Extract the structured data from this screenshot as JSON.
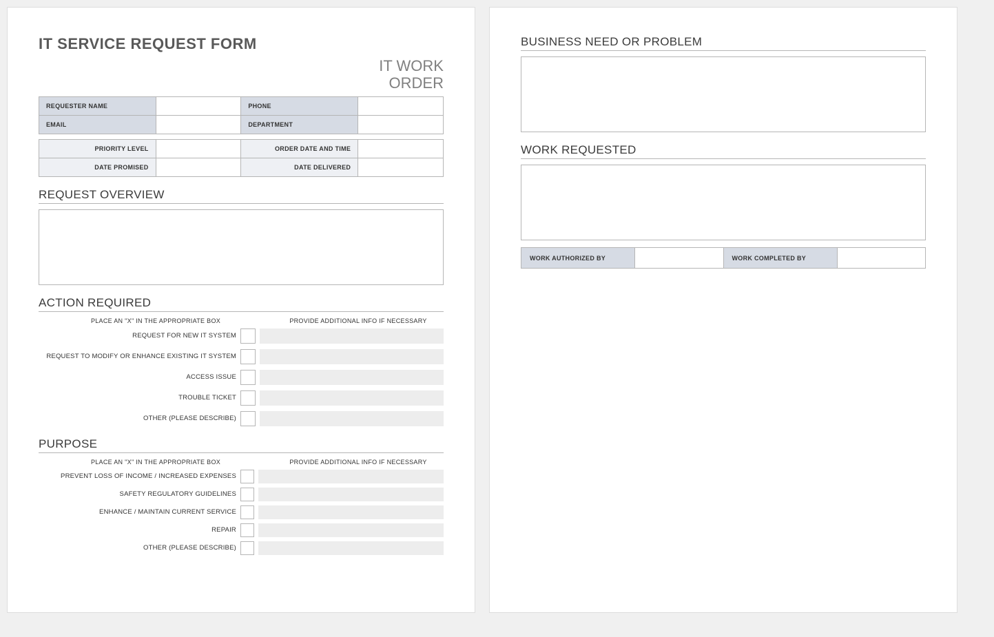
{
  "title": "IT SERVICE REQUEST FORM",
  "subtitle_line1": "IT WORK",
  "subtitle_line2": "ORDER",
  "info": {
    "requester_name_label": "REQUESTER NAME",
    "requester_name_value": "",
    "phone_label": "PHONE",
    "phone_value": "",
    "email_label": "EMAIL",
    "email_value": "",
    "department_label": "DEPARTMENT",
    "department_value": "",
    "priority_label": "PRIORITY LEVEL",
    "priority_value": "",
    "order_date_label": "ORDER DATE AND TIME",
    "order_date_value": "",
    "date_promised_label": "DATE PROMISED",
    "date_promised_value": "",
    "date_delivered_label": "DATE DELIVERED",
    "date_delivered_value": ""
  },
  "sections": {
    "request_overview": "REQUEST OVERVIEW",
    "action_required": "ACTION REQUIRED",
    "purpose": "PURPOSE",
    "business_need": "BUSINESS NEED OR PROBLEM",
    "work_requested": "WORK REQUESTED"
  },
  "check_instructions": {
    "left": "PLACE AN \"X\" IN THE APPROPRIATE BOX",
    "right": "PROVIDE ADDITIONAL INFO IF NECESSARY"
  },
  "action_items": [
    "REQUEST FOR NEW IT SYSTEM",
    "REQUEST TO MODIFY OR ENHANCE EXISTING IT SYSTEM",
    "ACCESS ISSUE",
    "TROUBLE TICKET",
    "OTHER (PLEASE DESCRIBE)"
  ],
  "purpose_items": [
    "PREVENT LOSS OF INCOME / INCREASED EXPENSES",
    "SAFETY REGULATORY GUIDELINES",
    "ENHANCE / MAINTAIN CURRENT SERVICE",
    "REPAIR",
    "OTHER (PLEASE DESCRIBE)"
  ],
  "auth": {
    "authorized_label": "WORK AUTHORIZED BY",
    "authorized_value": "",
    "completed_label": "WORK COMPLETED BY",
    "completed_value": ""
  }
}
